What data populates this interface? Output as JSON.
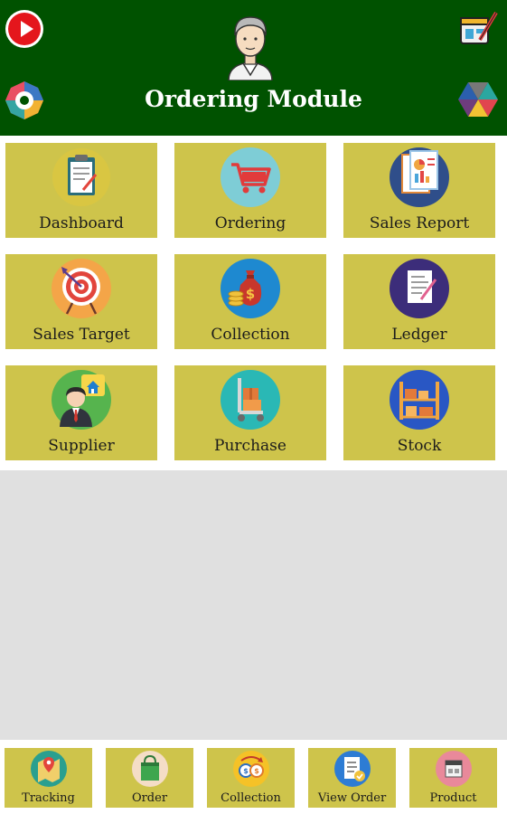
{
  "header": {
    "title": "Ordering Module",
    "background_color": "#005200",
    "icons": [
      "youtube-play-icon",
      "edit-icon",
      "settings-icon",
      "palette-icon",
      "user-avatar"
    ]
  },
  "modules": [
    {
      "label": "Dashboard",
      "icon": "clipboard-icon"
    },
    {
      "label": "Ordering",
      "icon": "shopping-cart-icon"
    },
    {
      "label": "Sales Report",
      "icon": "report-icon"
    },
    {
      "label": "Sales Target",
      "icon": "target-icon"
    },
    {
      "label": "Collection",
      "icon": "money-bag-icon"
    },
    {
      "label": "Ledger",
      "icon": "ledger-icon"
    },
    {
      "label": "Supplier",
      "icon": "supplier-icon"
    },
    {
      "label": "Purchase",
      "icon": "purchase-trolley-icon"
    },
    {
      "label": "Stock",
      "icon": "stock-shelf-icon"
    }
  ],
  "bottom_nav": [
    {
      "label": "Tracking",
      "icon": "map-tracking-icon"
    },
    {
      "label": "Order",
      "icon": "shopping-bag-icon"
    },
    {
      "label": "Collection",
      "icon": "coins-icon"
    },
    {
      "label": "View Order",
      "icon": "order-list-icon"
    },
    {
      "label": "Product",
      "icon": "product-icon"
    }
  ],
  "colors": {
    "tile": "#cec44b",
    "page_background": "#e0e0e0"
  }
}
